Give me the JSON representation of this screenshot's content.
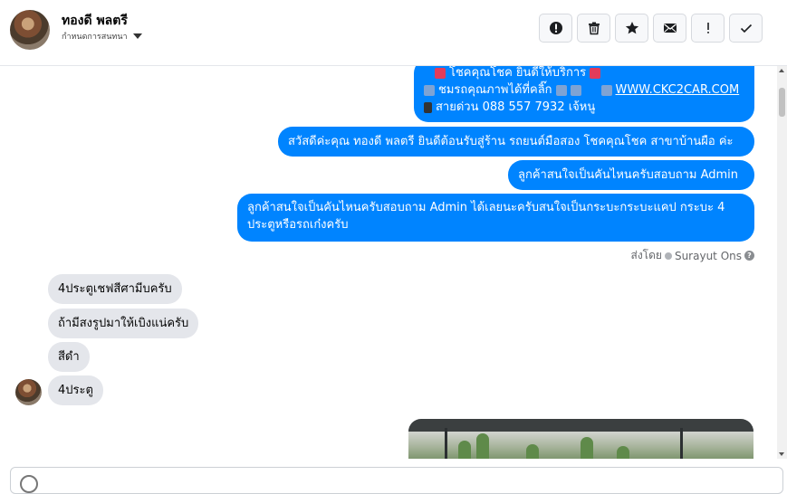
{
  "header": {
    "name": "ทองดี พลตรี",
    "subtitle": "กำหนดการสนทนา",
    "toolbar": [
      {
        "icon": "alert-circle-icon",
        "name": "report-button"
      },
      {
        "icon": "trash-icon",
        "name": "delete-button"
      },
      {
        "icon": "star-icon",
        "name": "star-button"
      },
      {
        "icon": "envelope-icon",
        "name": "mark-unread-button"
      },
      {
        "icon": "exclamation-icon",
        "name": "spam-button"
      },
      {
        "icon": "check-icon",
        "name": "done-button"
      }
    ]
  },
  "messages": {
    "outgoing": {
      "m1_line1": "โชคคุณโชค ยินดีให้บริการ",
      "m1_line2a": "ชมรถคุณภาพได้ที่คลิ๊ก",
      "m1_link": "WWW.CKC2CAR.COM",
      "m1_line3": "สายด่วน 088 557 7932 เจ้หนู",
      "m2": "สวัสดีค่ะคุณ ทองดี พลตรี ยินดีต้อนรับสู่ร้าน รถยนต์มือสอง โชคคุณโชค สาขาบ้านผือ ค่ะ",
      "m3": "ลูกค้าสนใจเป็นคันไหนครับสอบถาม Admin",
      "m4": "ลูกค้าสนใจเป็นคันไหนครับสอบถาม Admin ได้เลยนะครับสนใจเป็นกระบะกระบะแคป กระบะ 4 ประตูหรือรถเก๋งครับ"
    },
    "sent_by": "ส่งโดย",
    "sender": "Surayut Ons",
    "help_glyph": "?",
    "incoming": [
      "4ประตูเชฟสีศามีบครับ",
      "ถ้ามีสงรูปมาให้เบิงแน่ครับ",
      "สีดำ",
      "4ประตู"
    ]
  },
  "colors": {
    "accent": "#0084ff",
    "incoming_bubble": "#e4e6eb",
    "link": "#ffffff"
  }
}
